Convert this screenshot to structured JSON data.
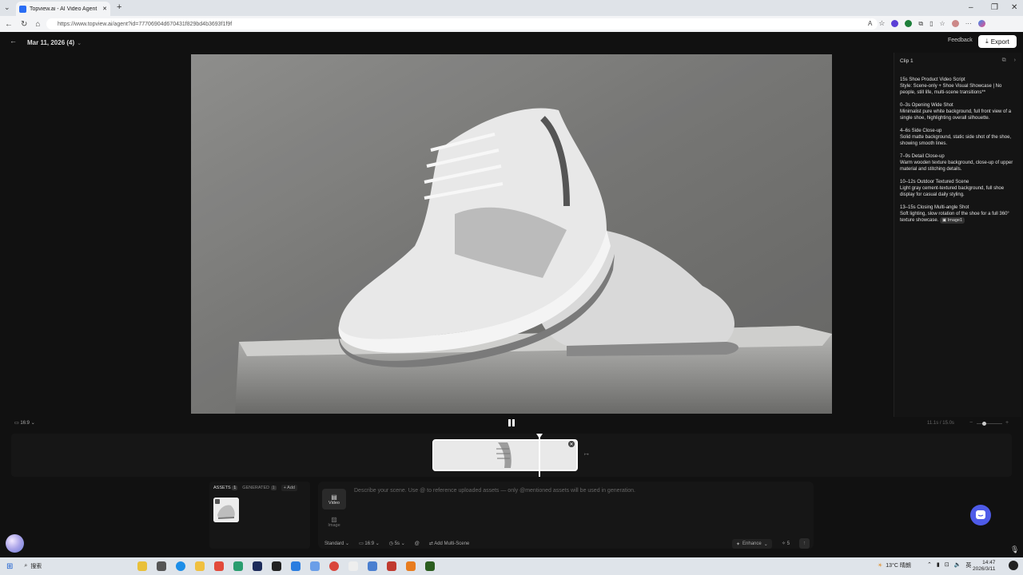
{
  "browser": {
    "tab_title": "Topview.ai - AI Video Agent",
    "url": "https://www.topview.ai/agent?id=77706904d670431f829bd4b3693f1f9f"
  },
  "app": {
    "project_title": "Mar 11, 2026 (4)",
    "feedback_label": "Feedback",
    "export_label": "Export"
  },
  "panel": {
    "clip_title": "Clip 1",
    "script": {
      "title": "15s Shoe Product Video Script",
      "style": "Style: Scene-only + Shoe Visual Showcase | No people, still life, multi-scene transitions**"
    },
    "scenes": [
      {
        "heading": "0–3s Opening Wide Shot",
        "body": "Minimalist pure white background, full front view of a single shoe, highlighting overall silhouette."
      },
      {
        "heading": "4–6s Side Close-up",
        "body": "Solid matte background, static side shot of the shoe, showing smooth lines."
      },
      {
        "heading": "7–9s Detail Close-up",
        "body": "Warm wooden texture background, close-up of upper material and stitching details."
      },
      {
        "heading": "10–12s Outdoor Textured Scene",
        "body": "Light gray cement-textured background, full shoe display for casual daily styling."
      },
      {
        "heading": "13–15s Closing Multi-angle Shot",
        "body": "Soft lighting, slow rotation of the shoe for a full 360° texture showcase."
      }
    ],
    "image_chip": "Image1"
  },
  "player": {
    "aspect_ratio": "16:9",
    "time_readout": "11.1s / 15.0s"
  },
  "assets": {
    "tab_assets": "ASSETS",
    "assets_count": "1",
    "tab_generated": "GENERATED",
    "generated_count": "1",
    "add_label": "+ Add"
  },
  "composer": {
    "placeholder": "Describe your scene. Use @ to reference uploaded assets — only @mentioned assets will be used in generation.",
    "mode_video": "Video",
    "mode_image": "Image",
    "quality": "Standard",
    "ratio": "16:9",
    "duration": "5s",
    "at": "@",
    "multi_scene": "Add Multi-Scene",
    "enhance": "Enhance",
    "credits": "5"
  },
  "taskbar": {
    "search": "搜索",
    "weather": "13°C 晴朗",
    "ime": "英",
    "time": "14:47",
    "date": "2026/3/11"
  },
  "colors": {
    "accent": "#4e5be8",
    "app_bg": "#111111"
  }
}
